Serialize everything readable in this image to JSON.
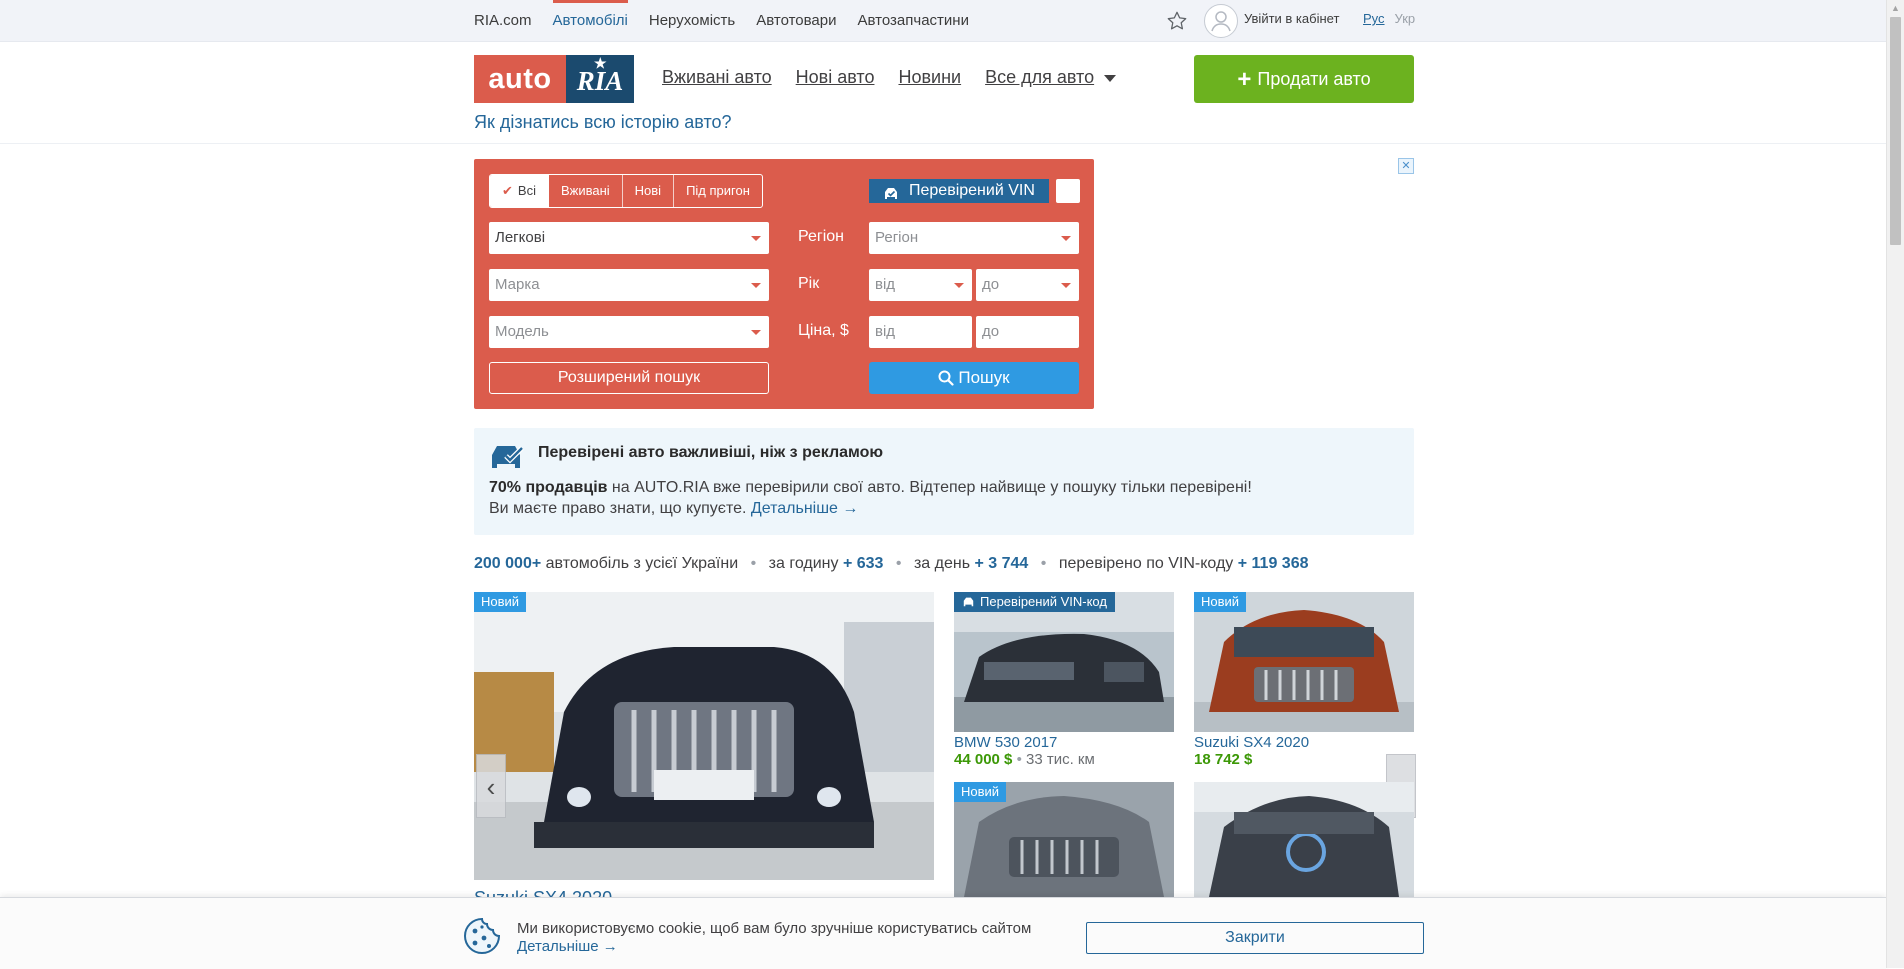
{
  "topbar": {
    "items": [
      {
        "label": "RIA.com"
      },
      {
        "label": "Автомобілі"
      },
      {
        "label": "Нерухомість"
      },
      {
        "label": "Автотовари"
      },
      {
        "label": "Автозапчастини"
      }
    ],
    "cabinet_label": "Увійти в кабінет",
    "lang_ru": "Рус",
    "lang_ua": "Укр"
  },
  "header": {
    "logo_auto": "auto",
    "logo_ria": "RIA",
    "nav": [
      {
        "label": "Вживані авто"
      },
      {
        "label": "Нові авто"
      },
      {
        "label": "Новини"
      },
      {
        "label": "Все для авто"
      }
    ],
    "sell_label": "Продати авто",
    "history_link": "Як дізнатись всю історію авто?"
  },
  "search": {
    "segments": [
      "Всі",
      "Вживані",
      "Нові",
      "Під пригон"
    ],
    "active_segment": "Всі",
    "vin_label": "Перевірений VIN",
    "type_value": "Легкові",
    "brand_placeholder": "Марка",
    "model_placeholder": "Модель",
    "region_label": "Регіон",
    "region_placeholder": "Регіон",
    "year_label": "Рік",
    "year_from": "від",
    "year_to": "до",
    "price_label": "Ціна, $",
    "price_from": "від",
    "price_to": "до",
    "advanced_label": "Розширений пошук",
    "search_button": "Пошук",
    "accent_color": "#db5c4c"
  },
  "info": {
    "title": "Перевірені авто важливіші, ніж з рекламою",
    "line1_bold": "70% продавців",
    "line1_rest": " на AUTO.RIA вже перевірили свої авто. Відтепер найвище у пошуку тільки перевірені!",
    "line2": "Ви маєте право знати, що купуєте.",
    "line2_link": "Детальніше →"
  },
  "stats": {
    "total": "200 000+",
    "total_text": "автомобіль з усієї України",
    "hour_text": "за годину",
    "hour_value": "+ 633",
    "day_text": "за день",
    "day_value": "+ 3 744",
    "vin_text": "перевірено по VIN-коду",
    "vin_value": "+ 119 368"
  },
  "cards": {
    "big": {
      "badge": "Новий",
      "title": "Suzuki SX4 2020",
      "prev_icon": "‹",
      "next_icon": "›"
    },
    "items": [
      {
        "badge": "Перевірений VIN-код",
        "title": "BMW 530 2017",
        "price": "44 000 $",
        "mileage": "33 тис. км"
      },
      {
        "badge": "Новий",
        "title": "Suzuki SX4 2020",
        "price": "18 742 $"
      },
      {
        "badge": "Новий"
      },
      {}
    ]
  },
  "cookie": {
    "text": "Ми використовуємо cookie, щоб вам було зручніше користуватись сайтом",
    "link": "Детальніше →",
    "close_label": "Закрити"
  }
}
